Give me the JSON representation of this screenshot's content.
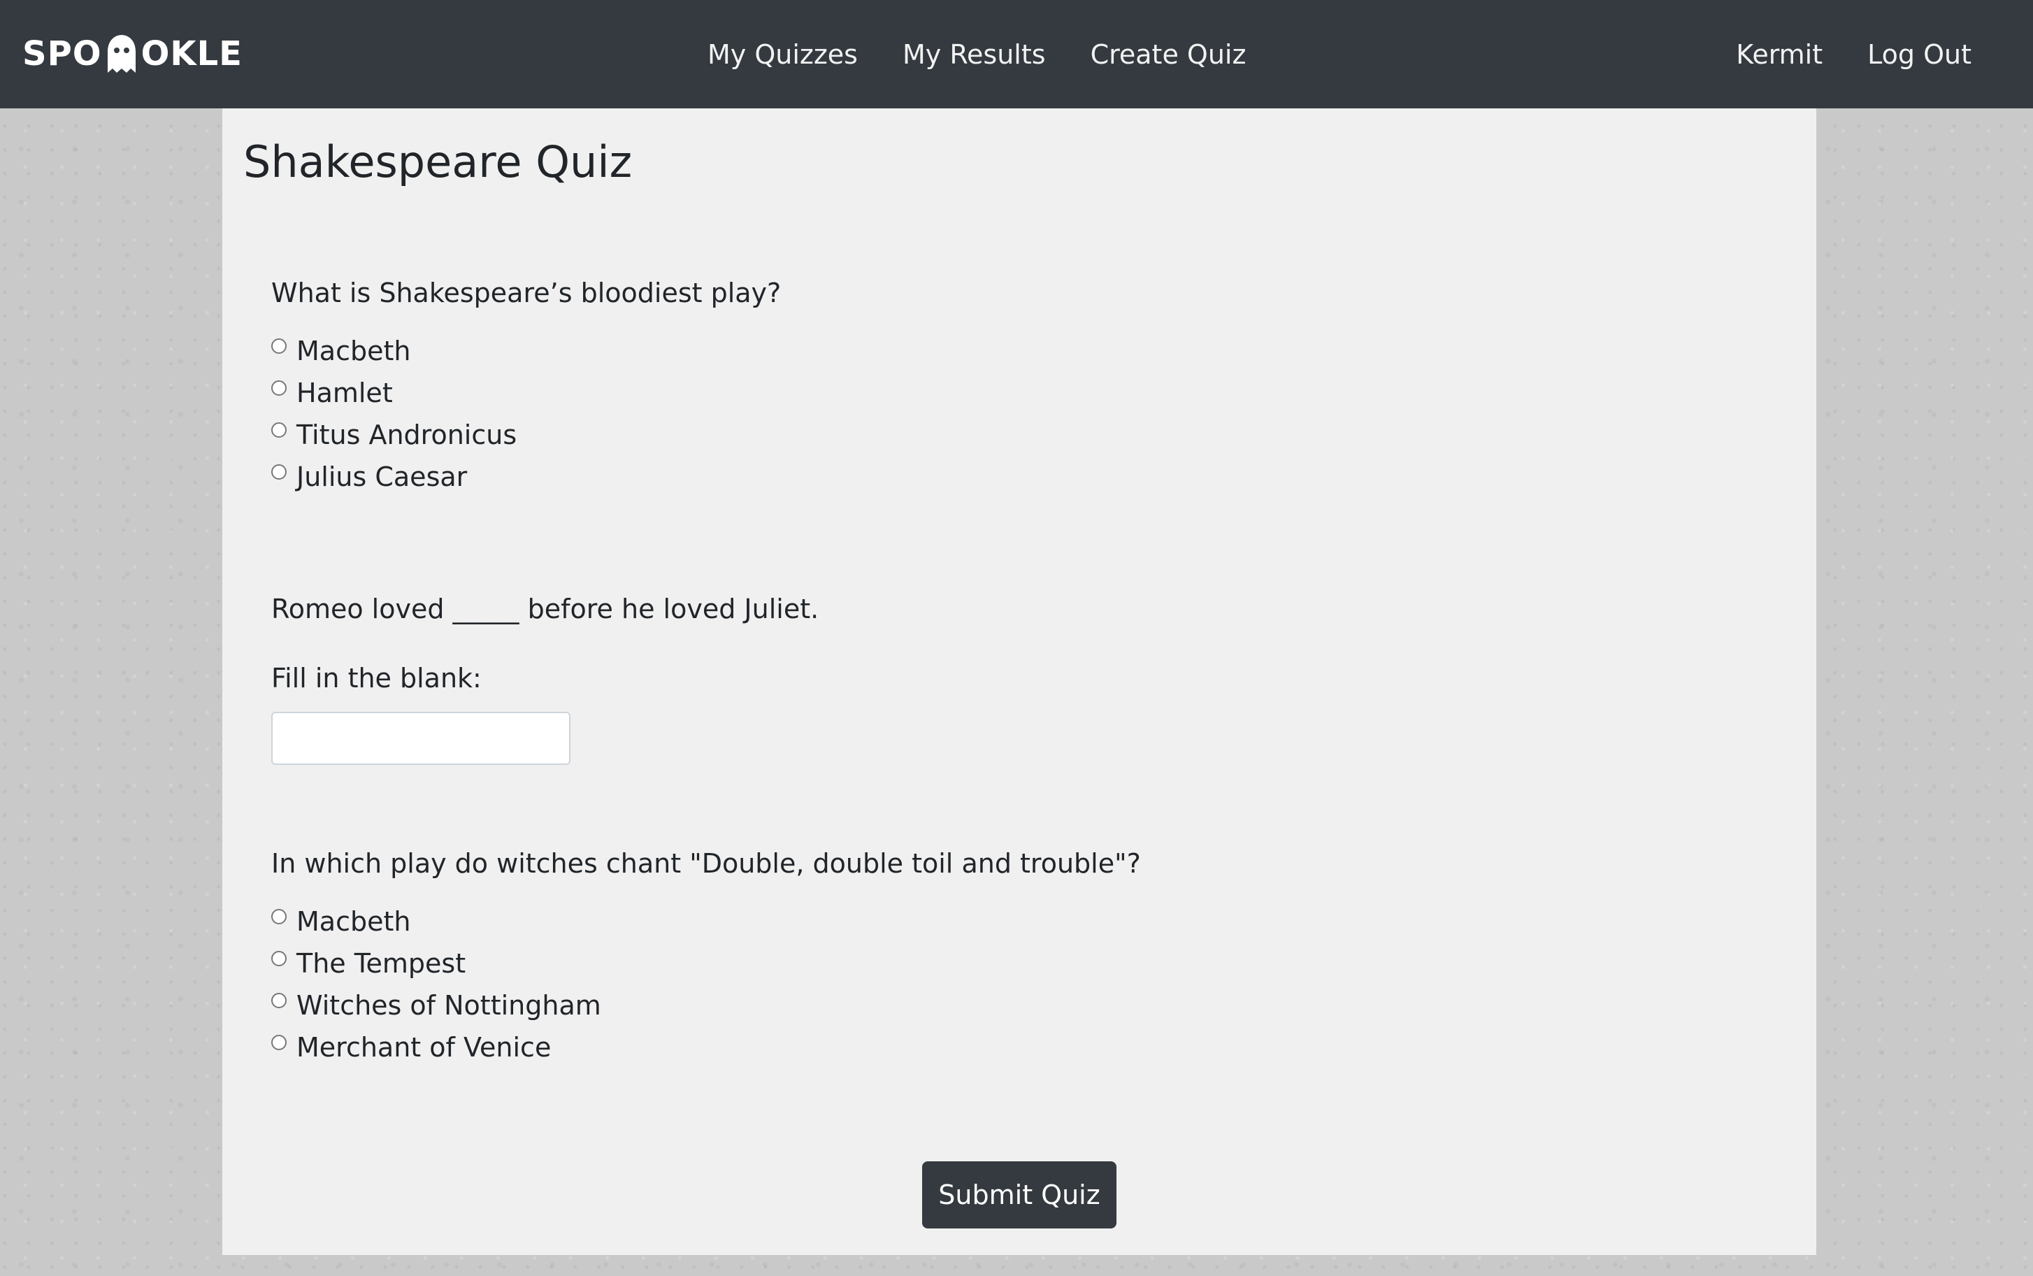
{
  "nav": {
    "logo_text_left": "SPO",
    "logo_text_right": "OKLE",
    "logo_icon": "ghost-icon",
    "links": [
      "My Quizzes",
      "My Results",
      "Create Quiz"
    ],
    "user": "Kermit",
    "logout": "Log Out"
  },
  "quiz": {
    "title": "Shakespeare Quiz",
    "questions": [
      {
        "text": "What is Shakespeare’s bloodiest play?",
        "options": [
          "Macbeth",
          "Hamlet",
          "Titus Andronicus",
          "Julius Caesar"
        ]
      },
      {
        "text": "Romeo loved _____ before he loved Juliet.",
        "fill_label": "Fill in the blank:",
        "input_value": ""
      },
      {
        "text": "In which play do witches chant \"Double, double toil and trouble\"?",
        "options": [
          "Macbeth",
          "The Tempest",
          "Witches of Nottingham",
          "Merchant of Venice"
        ]
      }
    ],
    "submit_label": "Submit Quiz"
  },
  "colors": {
    "navbar": "#343a40",
    "panel": "#f0f0f0",
    "button": "#343a40"
  }
}
